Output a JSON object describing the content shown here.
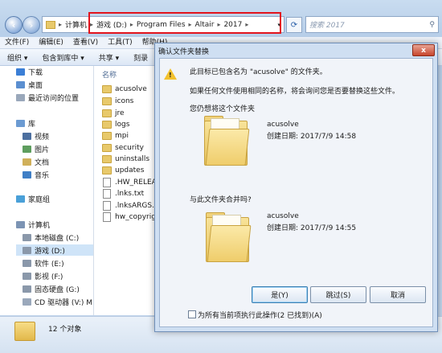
{
  "address": {
    "segments": [
      "计算机",
      "游戏 (D:)",
      "Program Files",
      "Altair",
      "2017"
    ],
    "search_placeholder": "搜索 2017"
  },
  "menu": [
    "文件(F)",
    "编辑(E)",
    "查看(V)",
    "工具(T)",
    "帮助(H)"
  ],
  "toolbar": [
    "组织 ▾",
    "包含到库中 ▾",
    "共享 ▾",
    "刻录"
  ],
  "nav": {
    "items": [
      {
        "label": "下载",
        "color": "#3b7fd6"
      },
      {
        "label": "桌面",
        "color": "#5b8fd0"
      },
      {
        "label": "最近访问的位置",
        "color": "#9aa8bb"
      },
      {
        "label": "库",
        "color": "#6c9bd2"
      },
      {
        "label": "视频",
        "color": "#4c6f9f"
      },
      {
        "label": "图片",
        "color": "#5e9e5e"
      },
      {
        "label": "文档",
        "color": "#d0b05a"
      },
      {
        "label": "音乐",
        "color": "#3f7fc6"
      },
      {
        "label": "家庭组",
        "color": "#4aa0d8"
      },
      {
        "label": "计算机",
        "color": "#7c94b4"
      },
      {
        "label": "本地磁盘 (C:)",
        "color": "#8a98aa"
      },
      {
        "label": "游戏 (D:)",
        "color": "#8a98aa"
      },
      {
        "label": "软件 (E:)",
        "color": "#8a98aa"
      },
      {
        "label": "影视 (F:)",
        "color": "#8a98aa"
      },
      {
        "label": "固态硬盘 (G:)",
        "color": "#8a98aa"
      },
      {
        "label": "CD 驱动器 (V:) M",
        "color": "#9aa8bb"
      }
    ]
  },
  "files": {
    "column_name": "名称",
    "items": [
      {
        "name": "acusolve",
        "type": "folder"
      },
      {
        "name": "icons",
        "type": "folder"
      },
      {
        "name": "jre",
        "type": "folder"
      },
      {
        "name": "logs",
        "type": "folder"
      },
      {
        "name": "mpi",
        "type": "folder"
      },
      {
        "name": "security",
        "type": "folder"
      },
      {
        "name": "uninstalls",
        "type": "folder"
      },
      {
        "name": "updates",
        "type": "folder"
      },
      {
        "name": ".HW_RELEAS",
        "type": "file"
      },
      {
        "name": ".lnks.txt",
        "type": "file"
      },
      {
        "name": ".lnksARGS.txt",
        "type": "file"
      },
      {
        "name": "hw_copyrigh",
        "type": "file"
      }
    ]
  },
  "status": {
    "text": "12 个对象"
  },
  "dialog": {
    "title": "确认文件夹替换",
    "close_label": "x",
    "message": "此目标已包含名为 \"acusolve\" 的文件夹。",
    "explanation": "如果任何文件使用相同的名称，将会询问您是否要替换这些文件。",
    "question_merge_target": "您仍想将这个文件夹",
    "question_merge_source": "与此文件夹合并吗?",
    "target_folder": {
      "name": "acusolve",
      "date": "创建日期: 2017/7/9 14:58"
    },
    "source_folder": {
      "name": "acusolve",
      "date": "创建日期: 2017/7/9 14:55"
    },
    "buttons": {
      "yes": "是(Y)",
      "skip": "跳过(S)",
      "cancel": "取消"
    },
    "checkbox_label": "为所有当前项执行此操作(2 已找到)(A)"
  }
}
